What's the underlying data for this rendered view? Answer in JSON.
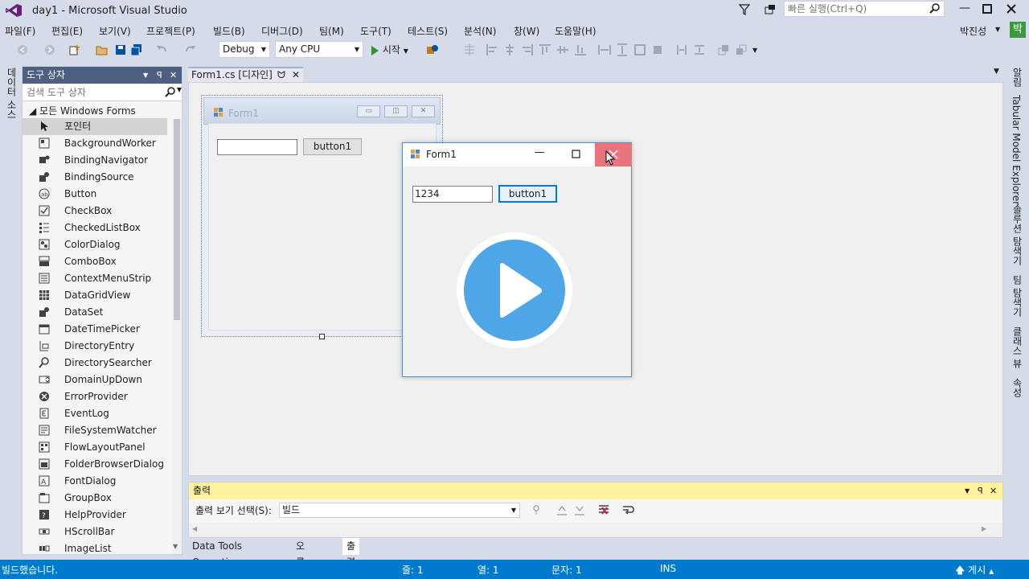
{
  "window": {
    "title": "day1 - Microsoft Visual Studio",
    "quicklaunch_placeholder": "빠른 실행(Ctrl+Q)",
    "user": "박진성",
    "user_badge": "박"
  },
  "menu": [
    "파일(F)",
    "편집(E)",
    "보기(V)",
    "프로젝트(P)",
    "빌드(B)",
    "디버그(D)",
    "팀(M)",
    "도구(T)",
    "테스트(S)",
    "분석(N)",
    "창(W)",
    "도움말(H)"
  ],
  "toolbar": {
    "config": "Debug",
    "platform": "Any CPU",
    "start_label": "시작"
  },
  "left_strip": {
    "tab": "데이터 소스"
  },
  "toolbox": {
    "title": "도구 상자",
    "search_placeholder": "검색 도구 상자",
    "group": "◢ 모든 Windows Forms",
    "items": [
      "포인터",
      "BackgroundWorker",
      "BindingNavigator",
      "BindingSource",
      "Button",
      "CheckBox",
      "CheckedListBox",
      "ColorDialog",
      "ComboBox",
      "ContextMenuStrip",
      "DataGridView",
      "DataSet",
      "DateTimePicker",
      "DirectoryEntry",
      "DirectorySearcher",
      "DomainUpDown",
      "ErrorProvider",
      "EventLog",
      "FileSystemWatcher",
      "FlowLayoutPanel",
      "FolderBrowserDialog",
      "FontDialog",
      "GroupBox",
      "HelpProvider",
      "HScrollBar",
      "ImageList"
    ]
  },
  "document": {
    "tab_label": "Form1.cs [디자인]"
  },
  "design_form": {
    "title": "Form1",
    "button_label": "button1"
  },
  "run_form": {
    "title": "Form1",
    "textbox_value": "1234",
    "button_label": "button1"
  },
  "output": {
    "title": "출력",
    "select_label": "출력 보기 선택(S):",
    "select_value": "빌드"
  },
  "bottom_tabs": [
    "Data Tools Operations",
    "오류 목록",
    "출력"
  ],
  "right_strip": [
    "알림",
    "Tabular Model Explorer",
    "솔루션 탐색기",
    "팀 탐색기",
    "클래스 뷰",
    "속성"
  ],
  "status": {
    "message": "빌드했습니다.",
    "line": "줄: 1",
    "col": "열: 1",
    "ch": "문자: 1",
    "ins": "INS",
    "publish": "게시"
  },
  "colors": {
    "chrome": "#d6dbe9",
    "toolbox_header": "#4d6082",
    "status_bar": "#007acc",
    "output_header": "#fff29d",
    "close_hover": "#e8747d",
    "play_button": "#4ea6e6"
  }
}
